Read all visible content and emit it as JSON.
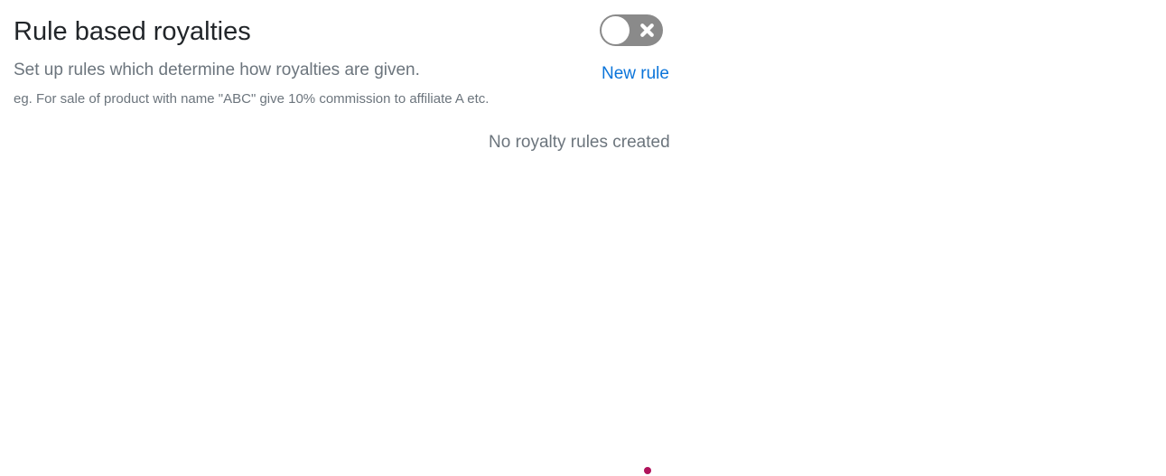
{
  "header": {
    "title": "Rule based royalties",
    "subtitle": "Set up rules which determine how royalties are given.",
    "example": "eg. For sale of product with name \"ABC\" give 10% commission to affiliate A etc."
  },
  "toggle": {
    "state": "off",
    "icon": "close-icon"
  },
  "actions": {
    "new_rule_label": "New rule"
  },
  "rules": {
    "empty_message": "No royalty rules created"
  },
  "colors": {
    "link": "#0a74da",
    "toggle_off": "#8a8a8a",
    "indicator_dot": "#b0125b"
  }
}
